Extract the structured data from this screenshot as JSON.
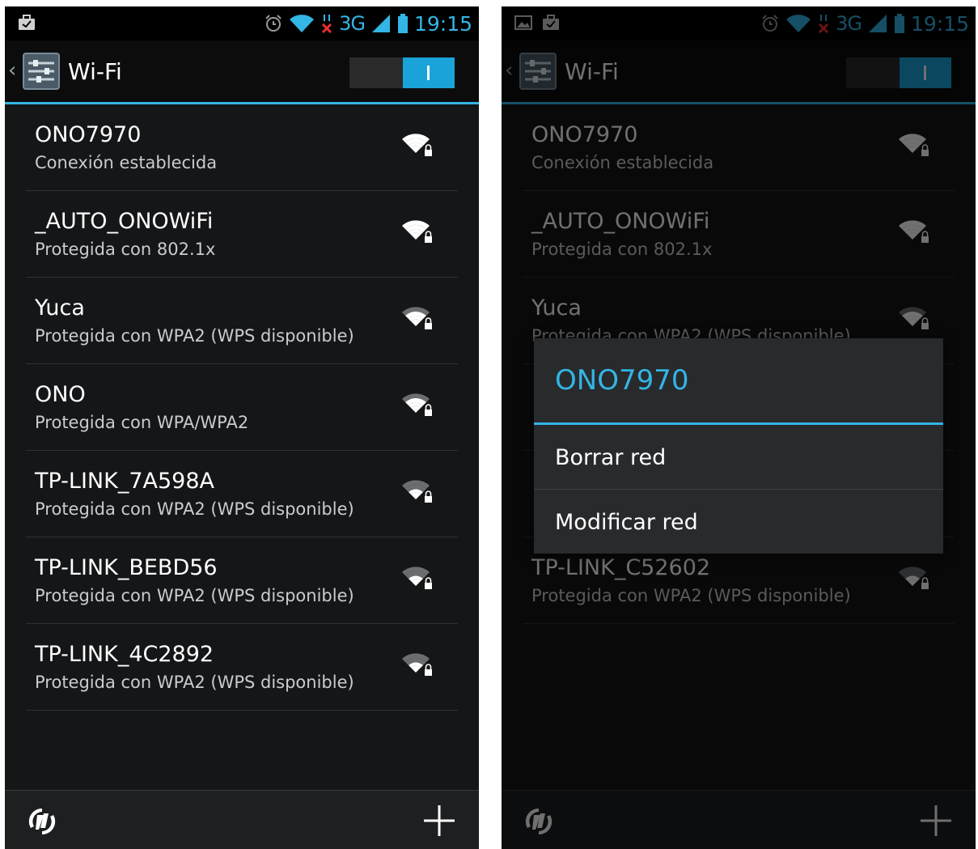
{
  "status_bar": {
    "time": "19:15",
    "network_type": "3G"
  },
  "action_bar": {
    "title": "Wi-Fi",
    "wifi_toggle_on": true
  },
  "networks": [
    {
      "name": "ONO7970",
      "status": "Conexión establecida",
      "signal": 4,
      "secured": true
    },
    {
      "name": "_AUTO_ONOWiFi",
      "status": "Protegida con 802.1x",
      "signal": 4,
      "secured": true
    },
    {
      "name": "Yuca",
      "status": "Protegida con WPA2 (WPS disponible)",
      "signal": 3,
      "secured": true
    },
    {
      "name": "ONO",
      "status": "Protegida con WPA/WPA2",
      "signal": 3,
      "secured": true
    },
    {
      "name": "TP-LINK_7A598A",
      "status": "Protegida con WPA2 (WPS disponible)",
      "signal": 2,
      "secured": true
    },
    {
      "name": "TP-LINK_BEBD56",
      "status": "Protegida con WPA2 (WPS disponible)",
      "signal": 2,
      "secured": true
    },
    {
      "name": "TP-LINK_4C2892",
      "status": "Protegida con WPA2 (WPS disponible)",
      "signal": 2,
      "secured": true
    }
  ],
  "networks_right": [
    {
      "name": "ONO7970",
      "status": "Conexión establecida",
      "signal": 4,
      "secured": true
    },
    {
      "name": "_AUTO_ONOWiFi",
      "status": "Protegida con 802.1x",
      "signal": 4,
      "secured": true
    },
    {
      "name": "Yuca",
      "status": "Protegida con WPA2 (WPS disponible)",
      "signal": 3,
      "secured": true
    },
    {
      "name": "",
      "status": "",
      "signal": 0,
      "secured": false
    },
    {
      "name": "",
      "status": "",
      "signal": 0,
      "secured": false
    },
    {
      "name": "TP-LINK_C52602",
      "status": "Protegida con WPA2 (WPS disponible)",
      "signal": 2,
      "secured": true
    }
  ],
  "dialog": {
    "title": "ONO7970",
    "items": [
      "Borrar red",
      "Modificar red"
    ]
  },
  "colors": {
    "accent": "#33b5e5",
    "background": "#151618",
    "text": "#ffffff",
    "subtext": "#c9cccf"
  },
  "icons": {
    "status_left_left": [
      "briefcase-icon"
    ],
    "status_left_right": [
      "image-icon",
      "briefcase-icon"
    ],
    "status_right": [
      "alarm-icon",
      "wifi-icon",
      "no-data-icon",
      "signal-icon",
      "battery-icon"
    ],
    "bottom": [
      "wps-scan-icon",
      "add-network-icon"
    ]
  }
}
